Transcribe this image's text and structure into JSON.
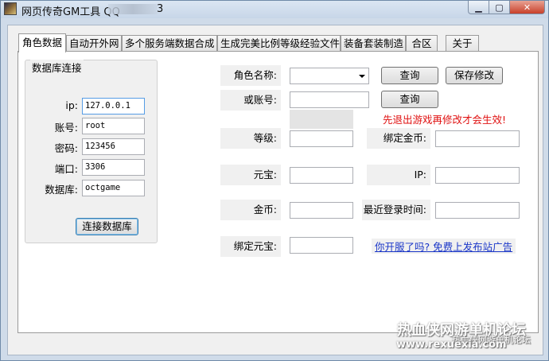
{
  "window": {
    "title_prefix": "网页传奇GM工具 QQ",
    "title_suffix": "3"
  },
  "tabs": [
    {
      "label": "角色数据",
      "active": true
    },
    {
      "label": "自动开外网"
    },
    {
      "label": "多个服务端数据合成"
    },
    {
      "label": "生成完美比例等级经验文件"
    },
    {
      "label": "装备套装制造"
    },
    {
      "label": "合区"
    },
    {
      "label": "关于"
    }
  ],
  "db": {
    "group_title": "数据库连接",
    "ip_label": "ip:",
    "ip_value": "127.0.0.1",
    "account_label": "账号:",
    "account_value": "root",
    "password_label": "密码:",
    "password_value": "123456",
    "port_label": "端口:",
    "port_value": "3306",
    "database_label": "数据库:",
    "database_value": "octgame",
    "connect_button": "连接数据库"
  },
  "role": {
    "name_label": "角色名称:",
    "name_value": "",
    "account_label": "或账号:",
    "account_value": "",
    "query_button": "查询",
    "query_button_2": "查询",
    "save_button": "保存修改",
    "warning": "先退出游戏再修改才会生效!",
    "level_label": "等级:",
    "level_value": "",
    "bound_gold_label": "绑定金币:",
    "bound_gold_value": "",
    "yuanbao_label": "元宝:",
    "yuanbao_value": "",
    "ip_label": "IP:",
    "ip_value": "",
    "gold_label": "金币:",
    "gold_value": "",
    "last_login_label": "最近登录时间:",
    "last_login_value": "",
    "bound_yuanbao_label": "绑定元宝:",
    "bound_yuanbao_value": "",
    "ad_link": "你开服了吗? 免费上发布站广告"
  },
  "watermark": {
    "line1": "热血侠网游单机论坛",
    "line2": "热血侠网游单机论坛",
    "line3": "www.rexuexia.com"
  },
  "colors": {
    "warning": "#e01010",
    "link": "#1a36c8",
    "titlebar": "#c7d6e8",
    "close_button": "#c8402a"
  }
}
